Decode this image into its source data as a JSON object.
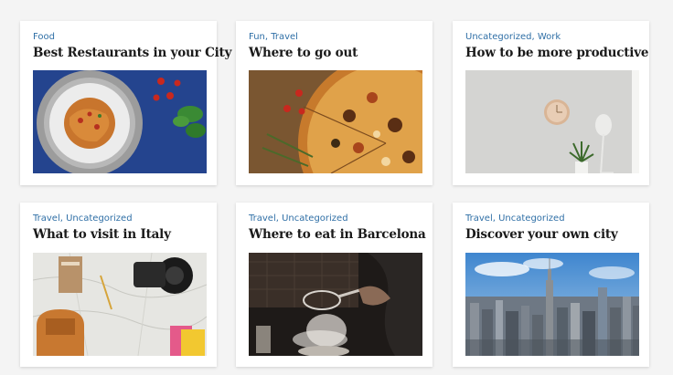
{
  "posts": [
    {
      "categories": [
        "Food"
      ],
      "category_text": "Food",
      "title": "Best Restaurants in your City",
      "image": "pasta-plate-image"
    },
    {
      "categories": [
        "Fun",
        "Travel"
      ],
      "category_text": "Fun, Travel",
      "title": "Where to go out",
      "image": "pizza-image"
    },
    {
      "categories": [
        "Uncategorized",
        "Work"
      ],
      "category_text": "Uncategorized, Work",
      "title": "How to be more productive",
      "image": "wall-clock-plant-image"
    },
    {
      "categories": [
        "Travel",
        "Uncategorized"
      ],
      "category_text": "Travel, Uncategorized",
      "title": "What to visit in Italy",
      "image": "travel-map-image"
    },
    {
      "categories": [
        "Travel",
        "Uncategorized"
      ],
      "category_text": "Travel, Uncategorized",
      "title": "Where to eat in Barcelona",
      "image": "flour-sifting-image"
    },
    {
      "categories": [
        "Travel",
        "Uncategorized"
      ],
      "category_text": "Travel, Uncategorized",
      "title": "Discover your own city",
      "image": "city-skyline-image"
    }
  ],
  "colors": {
    "category_link": "#2f6fa6",
    "title_text": "#1a1a1a",
    "card_bg": "#ffffff",
    "page_bg": "#f4f4f4"
  }
}
